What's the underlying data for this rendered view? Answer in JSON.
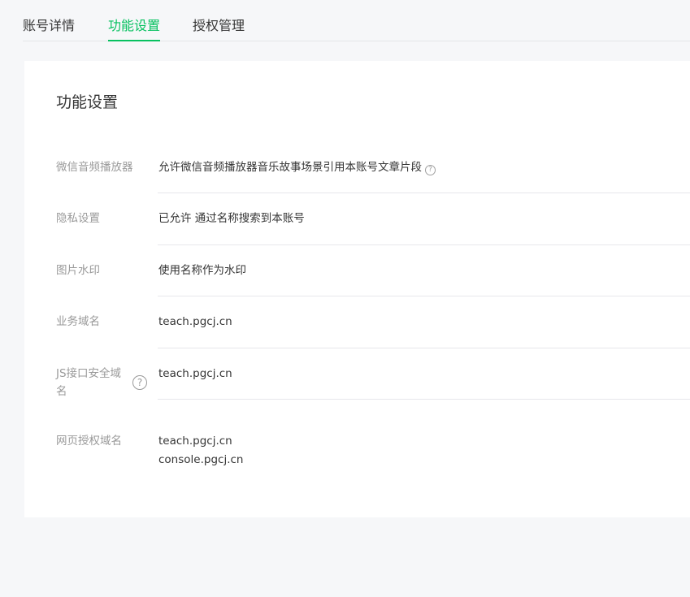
{
  "tabs": [
    {
      "label": "账号详情",
      "active": false
    },
    {
      "label": "功能设置",
      "active": true
    },
    {
      "label": "授权管理",
      "active": false
    }
  ],
  "card": {
    "title": "功能设置",
    "rows": [
      {
        "label": "微信音频播放器",
        "value": "允许微信音频播放器音乐故事场景引用本账号文章片段",
        "help_icon": "question-icon"
      },
      {
        "label": "隐私设置",
        "value": "已允许 通过名称搜索到本账号"
      },
      {
        "label": "图片水印",
        "value": "使用名称作为水印"
      },
      {
        "label": "业务域名",
        "value": "teach.pgcj.cn"
      },
      {
        "label": "JS接口安全域名",
        "value": "teach.pgcj.cn",
        "help_icon": "question-icon"
      },
      {
        "label": "网页授权域名",
        "values": [
          "teach.pgcj.cn",
          "console.pgcj.cn"
        ]
      }
    ]
  },
  "colors": {
    "accent": "#07c160",
    "page_bg": "#f6f7f9",
    "card_bg": "#ffffff",
    "label": "#9a9a9a",
    "text": "#353535",
    "divider": "#e7e7eb"
  }
}
